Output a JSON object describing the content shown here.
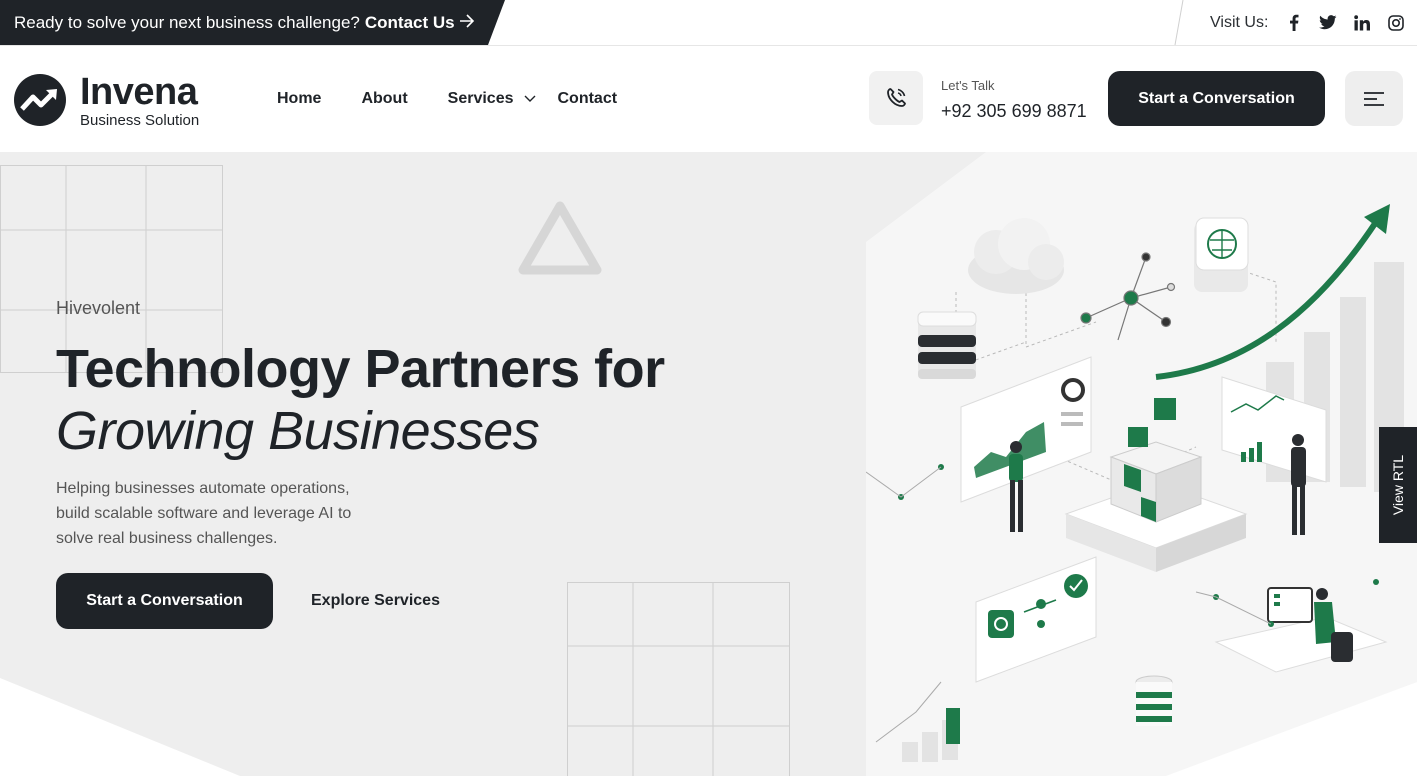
{
  "topbar": {
    "message": "Ready to solve your next business challenge?",
    "contact_label": "Contact Us",
    "arrow_icon": "arrow-right-icon",
    "visit_label": "Visit Us:",
    "socials": [
      "facebook-icon",
      "twitter-icon",
      "linkedin-icon",
      "instagram-icon"
    ]
  },
  "header": {
    "logo_title": "Invena",
    "logo_subtitle": "Business Solution",
    "nav": [
      "Home",
      "About",
      "Services",
      "Contact"
    ],
    "talk_label": "Let's Talk",
    "phone": "+92 305 699 8871",
    "cta_label": "Start a Conversation",
    "menu_icon": "menu-icon"
  },
  "hero": {
    "eyebrow": "Hivevolent",
    "title_line1": "Technology Partners for",
    "title_line2": "Growing Businesses",
    "description": "Helping businesses automate operations, build scalable software and leverage AI to solve real business challenges.",
    "primary_button": "Start a Conversation",
    "secondary_button": "Explore Services"
  },
  "side_tab": {
    "label": "View RTL"
  },
  "colors": {
    "dark": "#1f2328",
    "accent_green": "#1e7a4a",
    "hero_bg": "#eeeeee"
  }
}
